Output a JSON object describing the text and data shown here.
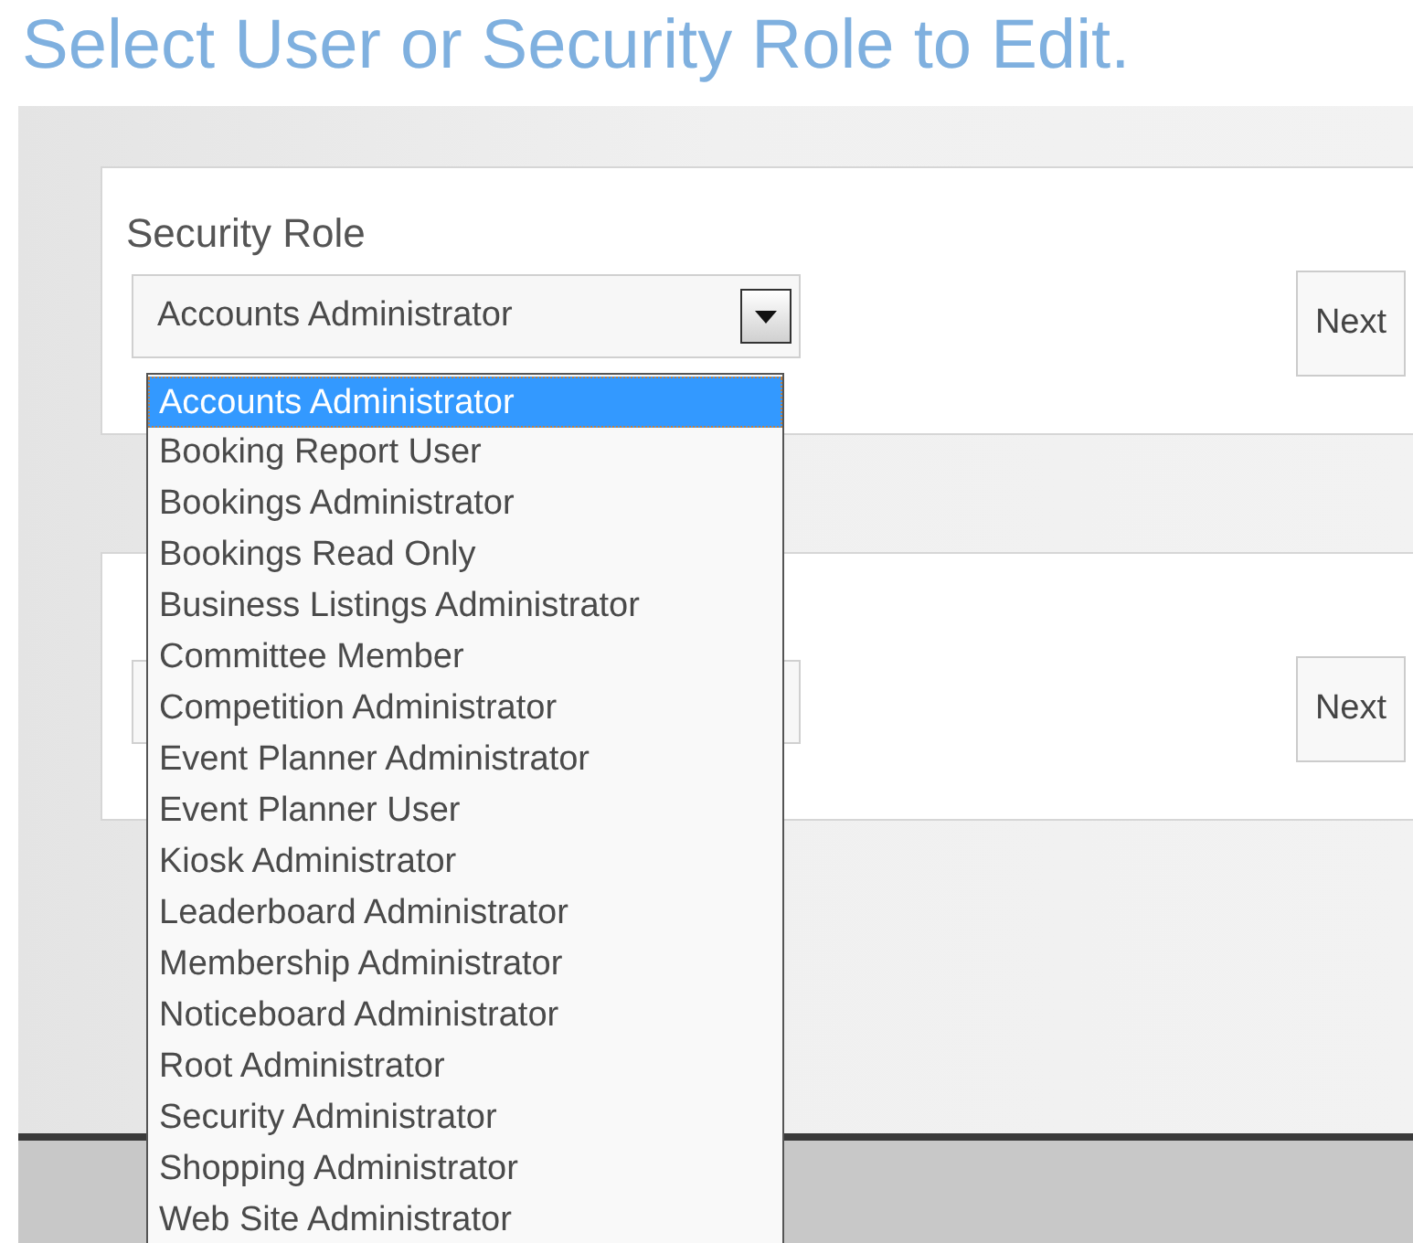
{
  "title": "Select User or Security Role to Edit.",
  "cards": [
    {
      "label": "Security Role",
      "select_value": "Accounts Administrator",
      "button": "Next"
    },
    {
      "button": "Next"
    }
  ],
  "dropdown_options": [
    {
      "label": "Accounts Administrator",
      "selected": true
    },
    {
      "label": "Booking Report User",
      "selected": false
    },
    {
      "label": "Bookings Administrator",
      "selected": false
    },
    {
      "label": "Bookings Read Only",
      "selected": false
    },
    {
      "label": "Business Listings Administrator",
      "selected": false
    },
    {
      "label": "Committee Member",
      "selected": false
    },
    {
      "label": "Competition Administrator",
      "selected": false
    },
    {
      "label": "Event Planner Administrator",
      "selected": false
    },
    {
      "label": "Event Planner User",
      "selected": false
    },
    {
      "label": "Kiosk Administrator",
      "selected": false
    },
    {
      "label": "Leaderboard Administrator",
      "selected": false
    },
    {
      "label": "Membership Administrator",
      "selected": false
    },
    {
      "label": "Noticeboard Administrator",
      "selected": false
    },
    {
      "label": "Root Administrator",
      "selected": false
    },
    {
      "label": "Security Administrator",
      "selected": false
    },
    {
      "label": "Shopping Administrator",
      "selected": false
    },
    {
      "label": "Web Site Administrator",
      "selected": false
    }
  ]
}
